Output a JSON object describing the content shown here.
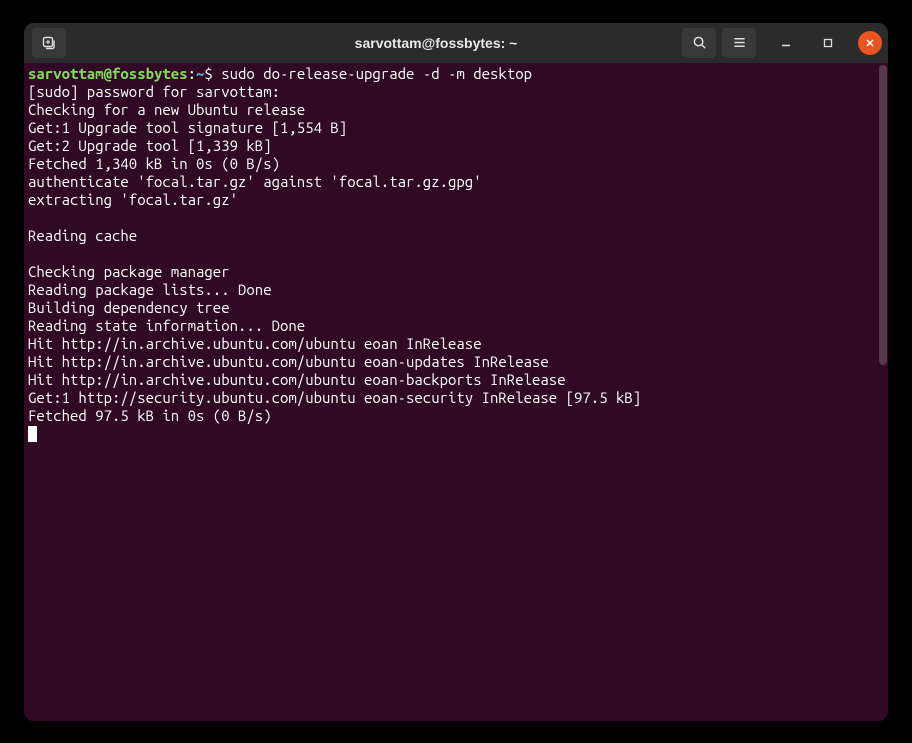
{
  "titlebar": {
    "title": "sarvottam@fossbytes: ~"
  },
  "prompt": {
    "user_host": "sarvottam@fossbytes",
    "colon": ":",
    "path": "~",
    "symbol": "$ "
  },
  "command": "sudo do-release-upgrade -d -m desktop",
  "output": [
    "[sudo] password for sarvottam: ",
    "Checking for a new Ubuntu release",
    "Get:1 Upgrade tool signature [1,554 B]",
    "Get:2 Upgrade tool [1,339 kB]",
    "Fetched 1,340 kB in 0s (0 B/s)",
    "authenticate 'focal.tar.gz' against 'focal.tar.gz.gpg'",
    "extracting 'focal.tar.gz'",
    "",
    "Reading cache",
    "",
    "Checking package manager",
    "Reading package lists... Done",
    "Building dependency tree",
    "Reading state information... Done",
    "Hit http://in.archive.ubuntu.com/ubuntu eoan InRelease",
    "Hit http://in.archive.ubuntu.com/ubuntu eoan-updates InRelease",
    "Hit http://in.archive.ubuntu.com/ubuntu eoan-backports InRelease",
    "Get:1 http://security.ubuntu.com/ubuntu eoan-security InRelease [97.5 kB]",
    "Fetched 97.5 kB in 0s (0 B/s)"
  ]
}
